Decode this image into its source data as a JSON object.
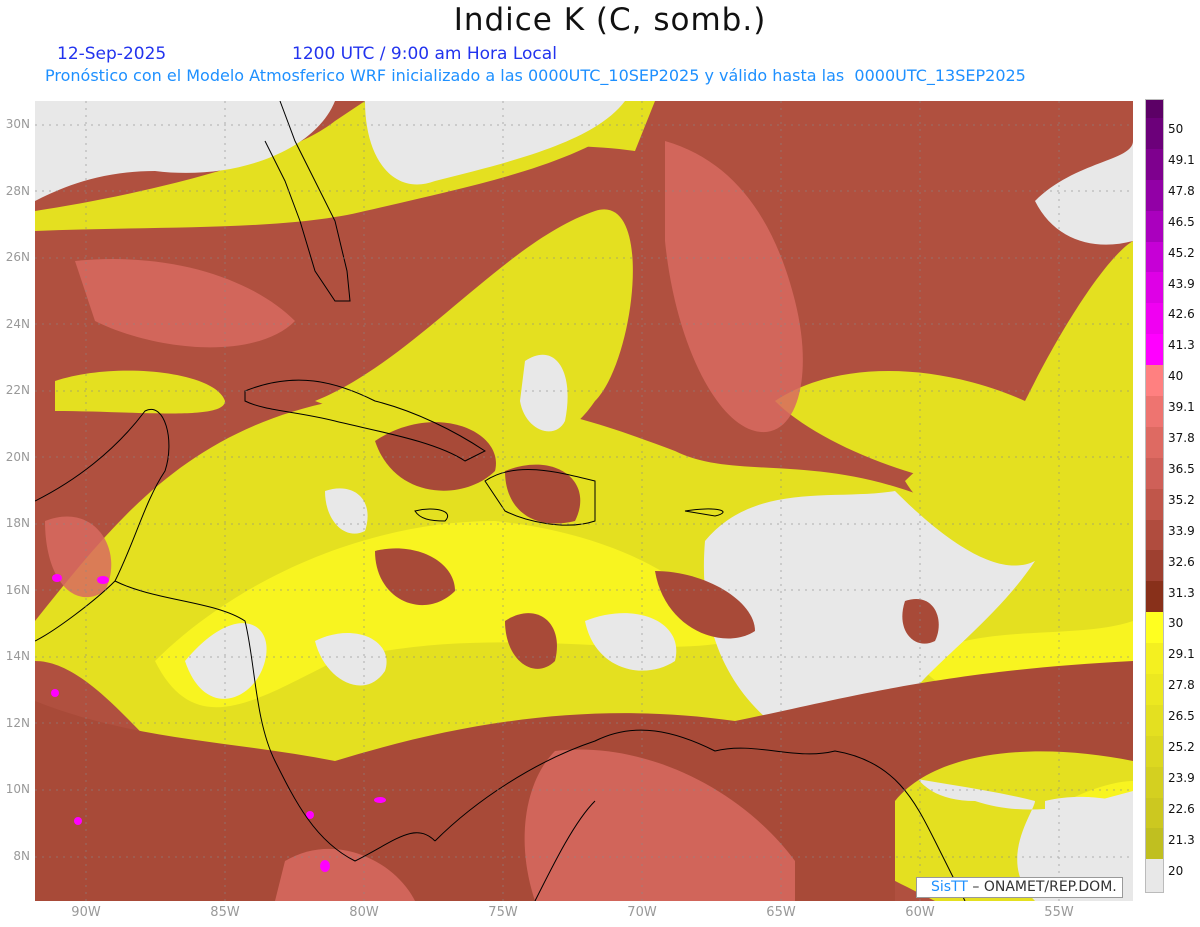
{
  "header": {
    "title": "Indice K (C, somb.)",
    "date": "12-Sep-2025",
    "time": "1200 UTC / 9:00 am Hora Local",
    "info": "Pronóstico con el Modelo Atmosferico WRF inicializado a las 0000UTC_10SEP2025 y válido hasta las  0000UTC_13SEP2025"
  },
  "axes": {
    "lat_labels": [
      "30N",
      "28N",
      "26N",
      "24N",
      "22N",
      "20N",
      "18N",
      "16N",
      "14N",
      "12N",
      "10N",
      "8N"
    ],
    "lon_labels": [
      "90W",
      "85W",
      "80W",
      "75W",
      "70W",
      "65W",
      "60W",
      "55W"
    ]
  },
  "colorbar": {
    "labels": [
      "50",
      "49.1",
      "47.8",
      "46.5",
      "45.2",
      "43.9",
      "42.6",
      "41.3",
      "40",
      "39.1",
      "37.8",
      "36.5",
      "35.2",
      "33.9",
      "32.6",
      "31.3",
      "30",
      "29.1",
      "27.8",
      "26.5",
      "25.2",
      "23.9",
      "22.6",
      "21.3",
      "20"
    ],
    "colors": [
      "#5c0066",
      "#6c007a",
      "#7e008e",
      "#9200a6",
      "#aa00be",
      "#c600d6",
      "#de00e6",
      "#f000f2",
      "#ff00ff",
      "#ff8080",
      "#ee7470",
      "#de6a62",
      "#cf6058",
      "#c0564a",
      "#b04c3e",
      "#9e4030",
      "#88301a",
      "#ffff20",
      "#f4f020",
      "#ece820",
      "#e4e020",
      "#dcd820",
      "#d4d020",
      "#ccc820",
      "#c0bf20",
      "#e8e8e8"
    ]
  },
  "credit": {
    "brand": "SisTT",
    "org": "– ONAMET/REP.DOM."
  }
}
